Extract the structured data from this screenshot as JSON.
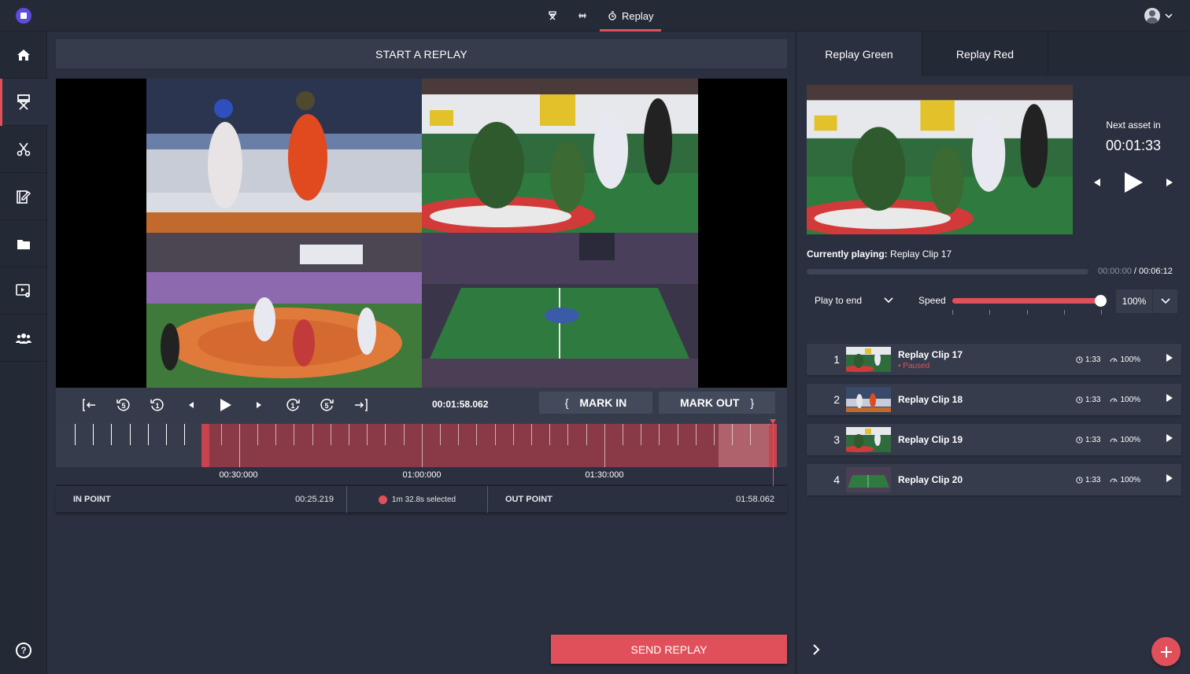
{
  "app": {
    "icons": {
      "logo": "app-logo-icon",
      "user": "user-avatar-icon",
      "user_menu": "chevron-down-icon"
    }
  },
  "topnav": {
    "items": [
      {
        "label": "",
        "icon": "director-chair-icon"
      },
      {
        "label": "",
        "icon": "timeline-icon"
      },
      {
        "label": "Replay",
        "icon": "replay-icon",
        "active": true
      }
    ]
  },
  "sidebar": {
    "items": [
      {
        "name": "home",
        "icon": "home-icon"
      },
      {
        "name": "director",
        "icon": "director-chair-icon",
        "active": true
      },
      {
        "name": "clip",
        "icon": "scissors-icon"
      },
      {
        "name": "edit",
        "icon": "edit-icon"
      },
      {
        "name": "files",
        "icon": "folder-icon"
      },
      {
        "name": "media-settings",
        "icon": "video-settings-icon"
      },
      {
        "name": "team",
        "icon": "users-icon"
      }
    ],
    "help_label": "?"
  },
  "main": {
    "header": "START A REPLAY",
    "controls": {
      "timecode": "00:01:58.062",
      "mark_in": "MARK IN",
      "mark_out": "MARK OUT",
      "mark_in_glyph": "{",
      "mark_out_glyph": "}",
      "skip_back_5": "5",
      "skip_back_1": "1",
      "skip_fwd_1": "1",
      "skip_fwd_5": "5"
    },
    "timeline": {
      "labels": [
        "00:30:000",
        "01:00:000",
        "01:30:000"
      ],
      "selection_start_fraction": 0.205,
      "selection_end_fraction": 0.986,
      "highlight_start_fraction": 0.906,
      "playhead_fraction": 0.981
    },
    "points": {
      "in_label": "IN POINT",
      "in_value": "00:25.219",
      "selected": "1m 32.8s selected",
      "out_label": "OUT POINT",
      "out_value": "01:58.062"
    },
    "send_button": "SEND REPLAY"
  },
  "right": {
    "tabs": [
      {
        "label": "Replay Green",
        "active": true
      },
      {
        "label": "Replay Red",
        "active": false
      }
    ],
    "next": {
      "label": "Next asset in",
      "time": "00:01:33"
    },
    "current": {
      "label": "Currently playing:",
      "value": "Replay Clip 17"
    },
    "progress": {
      "elapsed": "00:00:00",
      "separator": " / ",
      "total": "00:06:12",
      "fraction": 0
    },
    "play_mode": "Play to end",
    "speed": {
      "label": "Speed",
      "value": "100%",
      "fraction": 1.0
    },
    "queue": [
      {
        "index": "1",
        "title": "Replay Clip 17",
        "status": "• Paused",
        "duration": "1:33",
        "speed": "100%",
        "thumb": "goalie"
      },
      {
        "index": "2",
        "title": "Replay Clip 18",
        "status": "",
        "duration": "1:33",
        "speed": "100%",
        "thumb": "players"
      },
      {
        "index": "3",
        "title": "Replay Clip 19",
        "status": "",
        "duration": "1:33",
        "speed": "100%",
        "thumb": "goalie"
      },
      {
        "index": "4",
        "title": "Replay Clip 20",
        "status": "",
        "duration": "1:33",
        "speed": "100%",
        "thumb": "arena"
      }
    ],
    "add_label": "+"
  },
  "colors": {
    "accent": "#e0505b",
    "background": "#2b3040",
    "panel": "#363c4c",
    "sidebar": "#242936"
  }
}
